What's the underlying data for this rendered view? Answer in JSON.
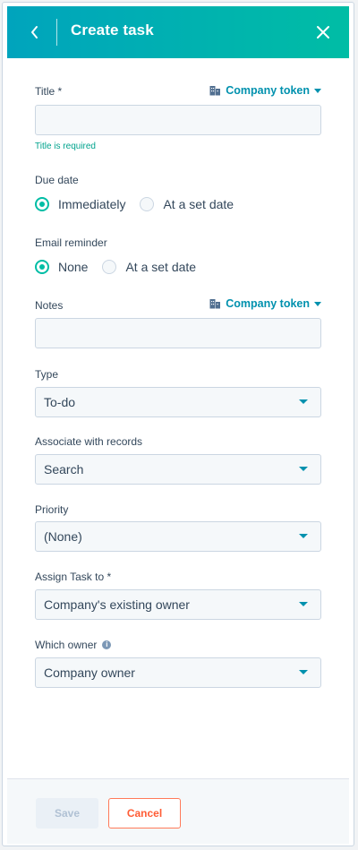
{
  "header": {
    "title": "Create task"
  },
  "colors": {
    "header_start": "#00a4bd",
    "header_end": "#00bda5",
    "accent": "#00bda5",
    "link": "#0091ae",
    "cancel": "#ff7a59"
  },
  "form": {
    "title": {
      "label": "Title *",
      "token_label": "Company token",
      "value": "",
      "error": "Title is required"
    },
    "due_date": {
      "label": "Due date",
      "options": [
        "Immediately",
        "At a set date"
      ],
      "selected": "Immediately"
    },
    "email_reminder": {
      "label": "Email reminder",
      "options": [
        "None",
        "At a set date"
      ],
      "selected": "None"
    },
    "notes": {
      "label": "Notes",
      "token_label": "Company token",
      "value": ""
    },
    "type": {
      "label": "Type",
      "value": "To-do"
    },
    "associate": {
      "label": "Associate with records",
      "value": "Search"
    },
    "priority": {
      "label": "Priority",
      "value": "(None)"
    },
    "assign_to": {
      "label": "Assign Task to *",
      "value": "Company's existing owner"
    },
    "which_owner": {
      "label": "Which owner",
      "info_icon": "info-icon",
      "value": "Company owner"
    }
  },
  "footer": {
    "save_label": "Save",
    "cancel_label": "Cancel"
  }
}
